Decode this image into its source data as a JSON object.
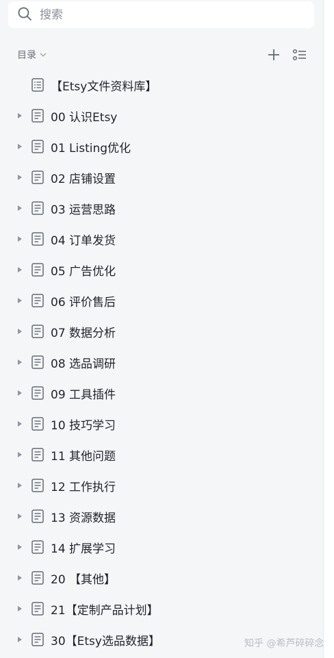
{
  "search": {
    "placeholder": "搜索",
    "icon": "search-icon"
  },
  "toc": {
    "title": "目录",
    "actions": [
      "plus-icon",
      "outline-list-icon"
    ]
  },
  "items": [
    {
      "label": "【Etsy文件资料库】",
      "expandable": false,
      "icon": "table-of-contents-icon"
    },
    {
      "label": "00 认识Etsy",
      "expandable": true,
      "icon": "document-icon"
    },
    {
      "label": "01 Listing优化",
      "expandable": true,
      "icon": "document-icon"
    },
    {
      "label": "02 店铺设置",
      "expandable": true,
      "icon": "document-icon"
    },
    {
      "label": "03 运营思路",
      "expandable": true,
      "icon": "document-icon"
    },
    {
      "label": "04 订单发货",
      "expandable": true,
      "icon": "document-icon"
    },
    {
      "label": "05 广告优化",
      "expandable": true,
      "icon": "document-icon"
    },
    {
      "label": "06 评价售后",
      "expandable": true,
      "icon": "document-icon"
    },
    {
      "label": "07 数据分析",
      "expandable": true,
      "icon": "document-icon"
    },
    {
      "label": "08 选品调研",
      "expandable": true,
      "icon": "document-icon"
    },
    {
      "label": "09 工具插件",
      "expandable": true,
      "icon": "document-icon"
    },
    {
      "label": "10 技巧学习",
      "expandable": true,
      "icon": "document-icon"
    },
    {
      "label": "11 其他问题",
      "expandable": true,
      "icon": "document-icon"
    },
    {
      "label": "12 工作执行",
      "expandable": true,
      "icon": "document-icon"
    },
    {
      "label": "13 资源数据",
      "expandable": true,
      "icon": "document-icon"
    },
    {
      "label": "14 扩展学习",
      "expandable": true,
      "icon": "document-icon"
    },
    {
      "label": "20 【其他】",
      "expandable": true,
      "icon": "document-icon"
    },
    {
      "label": "21【定制产品计划】",
      "expandable": true,
      "icon": "document-icon"
    },
    {
      "label": "30【Etsy选品数据】",
      "expandable": true,
      "icon": "document-icon"
    }
  ],
  "watermark": "知乎 @希芦碎碎念",
  "colors": {
    "panel_bg": "#f5f6f8",
    "text": "#1f2329",
    "icon": "#646a73"
  }
}
